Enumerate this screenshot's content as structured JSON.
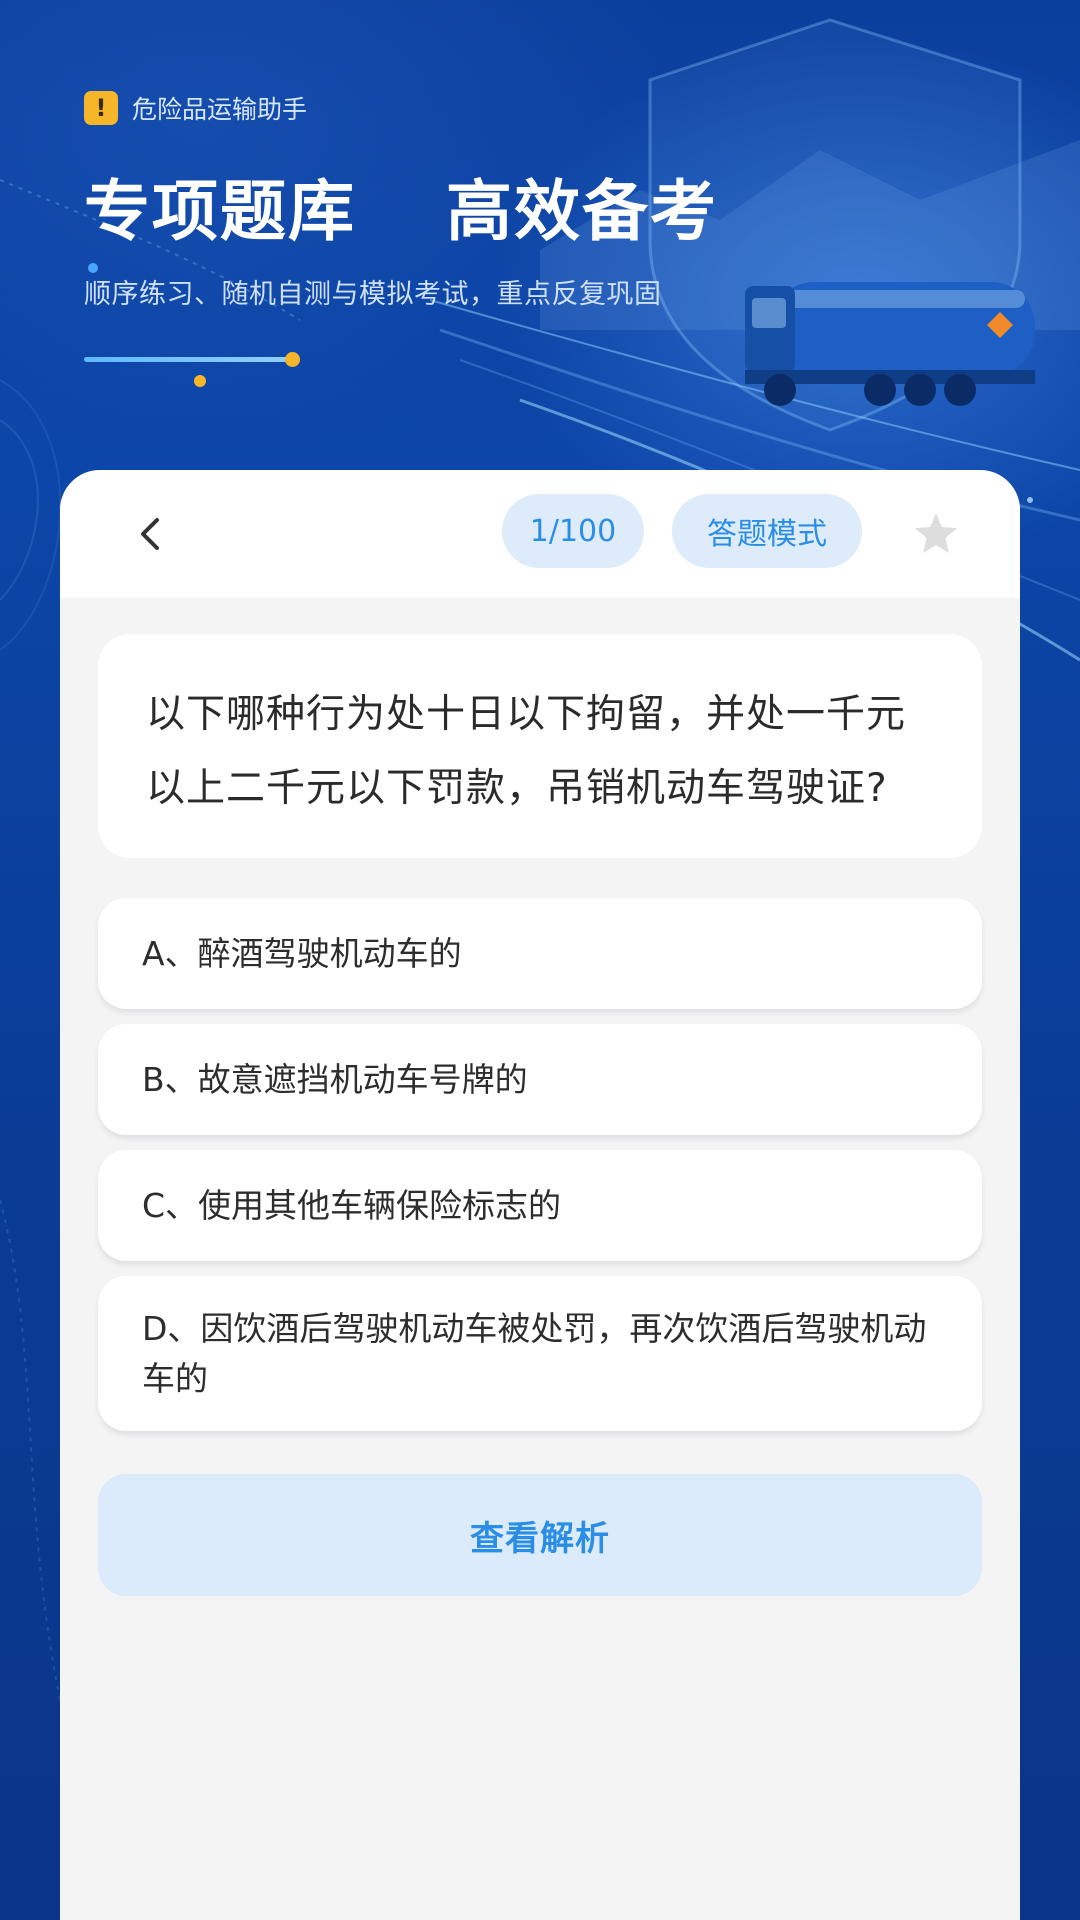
{
  "hero": {
    "app_name": "危险品运输助手",
    "title": "专项题库  高效备考",
    "subtitle": "顺序练习、随机自测与模拟考试，重点反复巩固",
    "warning_icon": "warning-icon"
  },
  "toolbar": {
    "back_icon": "chevron-left-icon",
    "progress": "1/100",
    "mode": "答题模式",
    "favorite_icon": "star-icon"
  },
  "question": {
    "text": "以下哪种行为处十日以下拘留，并处一千元以上二千元以下罚款，吊销机动车驾驶证?"
  },
  "options": [
    {
      "label": "A、醉酒驾驶机动车的"
    },
    {
      "label": "B、故意遮挡机动车号牌的"
    },
    {
      "label": "C、使用其他车辆保险标志的"
    },
    {
      "label": "D、因饮酒后驾驶机动车被处罚，再次饮酒后驾驶机动车的"
    }
  ],
  "actions": {
    "analysis": "查看解析"
  },
  "colors": {
    "accent": "#2a8ee6",
    "pill_bg": "#ddebfb",
    "hero_bg": "#0b3f9e",
    "warning": "#f5b62a"
  }
}
